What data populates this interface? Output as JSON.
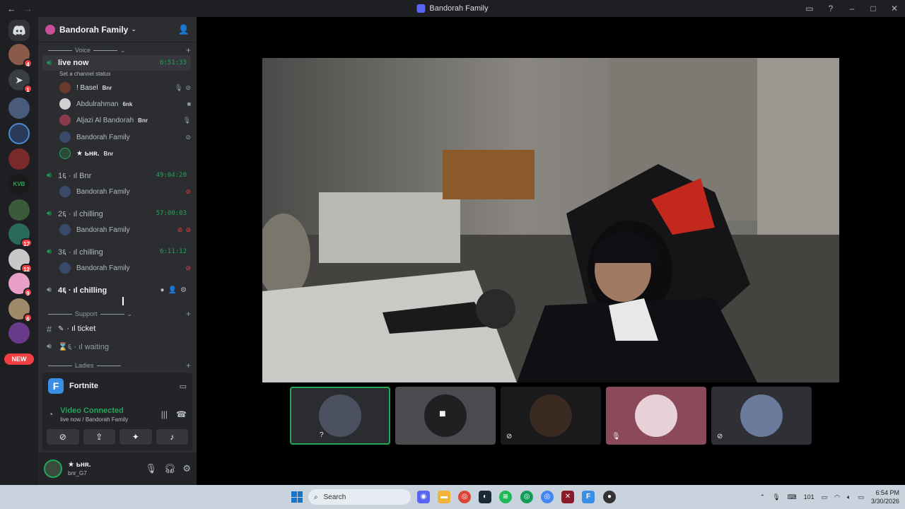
{
  "window": {
    "title": "Bandorah Family",
    "controls": [
      "minimize",
      "maximize",
      "close"
    ]
  },
  "rail": {
    "new_label": "NEW",
    "badges": [
      "4",
      "1",
      "17",
      "12",
      "9",
      "6"
    ]
  },
  "guild": {
    "name": "Bandorah Family"
  },
  "categories": {
    "voice": "Voice",
    "support": "Support",
    "ladies": "Ladies"
  },
  "channels": {
    "live_now": {
      "name": "live now",
      "time": "6:51:33",
      "status": "Set a channel status",
      "users": [
        {
          "name": "! Basel",
          "tag": "Bnr"
        },
        {
          "name": "Abdulrahman",
          "tag": "6nk"
        },
        {
          "name": "Aljazi Al Bandorah",
          "tag": "Bnr"
        },
        {
          "name": "Bandorah Family",
          "tag": ""
        },
        {
          "name": "★  ьнʀ.",
          "tag": "Bnr"
        }
      ]
    },
    "bnr": {
      "name": "1६ · ıl Bnr",
      "time": "49:04:20",
      "user": "Bandorah Family"
    },
    "chilling2": {
      "name": "2६ · ıl chilling",
      "time": "57:00:03",
      "user": "Bandorah Family"
    },
    "chilling3": {
      "name": "3६ · ıl chilling",
      "time": "6:11:12",
      "user": "Bandorah Family"
    },
    "chilling4": {
      "name": "4६ · ıl chilling"
    },
    "ticket": {
      "name": "· ıl ticket"
    },
    "waiting": {
      "name": "⌛६ · ıl waiting"
    }
  },
  "activity": {
    "name": "Fortnite"
  },
  "voice_connection": {
    "title": "Video Connected",
    "subtitle": "live now / Bandorah Family"
  },
  "user_panel": {
    "name": "★  ьнʀ.",
    "handle": "bnr_G7"
  },
  "taskbar": {
    "search_placeholder": "Search",
    "time": "6:54 PM",
    "date": "3/30/2026",
    "lang": "101"
  },
  "colors": {
    "accent_green": "#23a55a",
    "blurple": "#5865f2",
    "danger": "#f23f43"
  }
}
